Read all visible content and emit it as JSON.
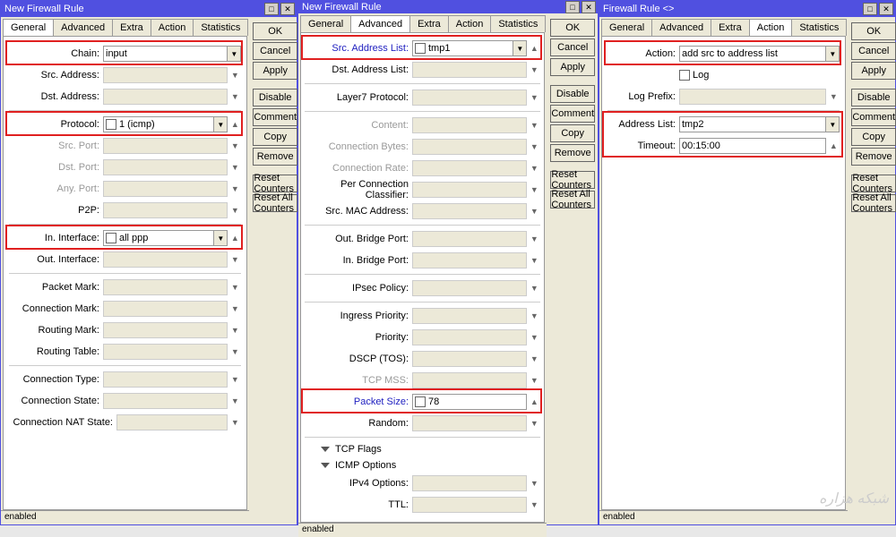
{
  "panel1": {
    "title": "New Firewall Rule",
    "tabs": [
      "General",
      "Advanced",
      "Extra",
      "Action",
      "Statistics"
    ],
    "active_tab": "General",
    "status": "enabled",
    "fields": {
      "chain_label": "Chain:",
      "chain_value": "input",
      "src_addr_label": "Src. Address:",
      "dst_addr_label": "Dst. Address:",
      "protocol_label": "Protocol:",
      "protocol_value": "1 (icmp)",
      "src_port_label": "Src. Port:",
      "dst_port_label": "Dst. Port:",
      "any_port_label": "Any. Port:",
      "p2p_label": "P2P:",
      "in_iface_label": "In. Interface:",
      "in_iface_value": "all ppp",
      "out_iface_label": "Out. Interface:",
      "packet_mark_label": "Packet Mark:",
      "conn_mark_label": "Connection Mark:",
      "routing_mark_label": "Routing Mark:",
      "routing_table_label": "Routing Table:",
      "conn_type_label": "Connection Type:",
      "conn_state_label": "Connection State:",
      "conn_nat_label": "Connection NAT State:"
    }
  },
  "panel2": {
    "title": "New Firewall Rule",
    "tabs": [
      "General",
      "Advanced",
      "Extra",
      "Action",
      "Statistics"
    ],
    "active_tab": "Advanced",
    "status": "enabled",
    "fields": {
      "src_al_label": "Src. Address List:",
      "src_al_value": "tmp1",
      "dst_al_label": "Dst. Address List:",
      "l7_label": "Layer7 Protocol:",
      "content_label": "Content:",
      "conn_bytes_label": "Connection Bytes:",
      "conn_rate_label": "Connection Rate:",
      "pcc_label": "Per Connection Classifier:",
      "src_mac_label": "Src. MAC Address:",
      "out_bridge_label": "Out. Bridge Port:",
      "in_bridge_label": "In. Bridge Port:",
      "ipsec_label": "IPsec Policy:",
      "ingress_label": "Ingress Priority:",
      "priority_label": "Priority:",
      "dscp_label": "DSCP (TOS):",
      "tcp_mss_label": "TCP MSS:",
      "packet_size_label": "Packet Size:",
      "packet_size_value": "78",
      "random_label": "Random:",
      "tcp_flags_label": "TCP Flags",
      "icmp_opts_label": "ICMP Options",
      "ipv4_opts_label": "IPv4 Options:",
      "ttl_label": "TTL:"
    }
  },
  "panel3": {
    "title": "Firewall Rule <>",
    "tabs": [
      "General",
      "Advanced",
      "Extra",
      "Action",
      "Statistics"
    ],
    "active_tab": "Action",
    "status": "enabled",
    "fields": {
      "action_label": "Action:",
      "action_value": "add src to address list",
      "log_label": "Log",
      "log_prefix_label": "Log Prefix:",
      "addr_list_label": "Address List:",
      "addr_list_value": "tmp2",
      "timeout_label": "Timeout:",
      "timeout_value": "00:15:00"
    }
  },
  "buttons": {
    "ok": "OK",
    "cancel": "Cancel",
    "apply": "Apply",
    "disable": "Disable",
    "comment": "Comment",
    "copy": "Copy",
    "remove": "Remove",
    "reset_counters": "Reset Counters",
    "reset_all_counters": "Reset All Counters"
  },
  "watermark": "شبکه هزاره"
}
